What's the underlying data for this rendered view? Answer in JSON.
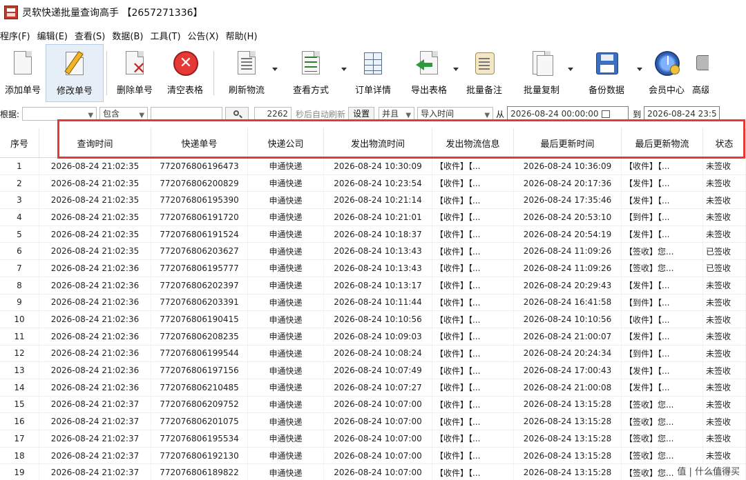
{
  "window": {
    "title": "灵软快递批量查询高手 【2657271336】"
  },
  "menu": [
    "程序(F)",
    "编辑(E)",
    "查看(S)",
    "数据(B)",
    "工具(T)",
    "公告(X)",
    "帮助(H)"
  ],
  "toolbar": {
    "add": "添加单号",
    "edit": "修改单号",
    "delete": "删除单号",
    "clear": "清空表格",
    "refresh": "刷新物流",
    "view_mode": "查看方式",
    "order_detail": "订单详情",
    "export": "导出表格",
    "batch_note": "批量备注",
    "batch_copy": "批量复制",
    "backup": "备份数据",
    "member": "会员中心",
    "more": "高级"
  },
  "filter": {
    "label": "根据:",
    "match_mode": "包含",
    "count": "2262",
    "auto_refresh_text": "秒后自动刷新",
    "settings_btn": "设置",
    "logic": "并且",
    "time_field": "导入时间",
    "from_label": "从",
    "date_from": "2026-08-24 00:00:00",
    "to_label": "到",
    "date_to": "2026-08-24 23:5"
  },
  "table": {
    "headers": [
      "序号",
      "查询时间",
      "快递单号",
      "快递公司",
      "发出物流时间",
      "发出物流信息",
      "最后更新时间",
      "最后更新物流",
      "状态"
    ],
    "rows": [
      [
        "1",
        "2026-08-24 21:02:35",
        "772076806196473",
        "申通快递",
        "2026-08-24 10:30:09",
        "【收件】【...",
        "2026-08-24 10:36:09",
        "【收件】【...",
        "未签收"
      ],
      [
        "2",
        "2026-08-24 21:02:35",
        "772076806200829",
        "申通快递",
        "2026-08-24 10:23:54",
        "【收件】【...",
        "2026-08-24 20:17:36",
        "【发件】【...",
        "未签收"
      ],
      [
        "3",
        "2026-08-24 21:02:35",
        "772076806195390",
        "申通快递",
        "2026-08-24 10:21:14",
        "【收件】【...",
        "2026-08-24 17:35:46",
        "【发件】【...",
        "未签收"
      ],
      [
        "4",
        "2026-08-24 21:02:35",
        "772076806191720",
        "申通快递",
        "2026-08-24 10:21:01",
        "【收件】【...",
        "2026-08-24 20:53:10",
        "【到件】【...",
        "未签收"
      ],
      [
        "5",
        "2026-08-24 21:02:35",
        "772076806191524",
        "申通快递",
        "2026-08-24 10:18:37",
        "【收件】【...",
        "2026-08-24 20:54:19",
        "【发件】【...",
        "未签收"
      ],
      [
        "6",
        "2026-08-24 21:02:35",
        "772076806203627",
        "申通快递",
        "2026-08-24 10:13:43",
        "【收件】【...",
        "2026-08-24 11:09:26",
        "【签收】您...",
        "已签收"
      ],
      [
        "7",
        "2026-08-24 21:02:36",
        "772076806195777",
        "申通快递",
        "2026-08-24 10:13:43",
        "【收件】【...",
        "2026-08-24 11:09:26",
        "【签收】您...",
        "已签收"
      ],
      [
        "8",
        "2026-08-24 21:02:36",
        "772076806202397",
        "申通快递",
        "2026-08-24 10:13:17",
        "【收件】【...",
        "2026-08-24 20:29:43",
        "【发件】【...",
        "未签收"
      ],
      [
        "9",
        "2026-08-24 21:02:36",
        "772076806203391",
        "申通快递",
        "2026-08-24 10:11:44",
        "【收件】【...",
        "2026-08-24 16:41:58",
        "【到件】【...",
        "未签收"
      ],
      [
        "10",
        "2026-08-24 21:02:36",
        "772076806190415",
        "申通快递",
        "2026-08-24 10:10:56",
        "【收件】【...",
        "2026-08-24 10:10:56",
        "【收件】【...",
        "未签收"
      ],
      [
        "11",
        "2026-08-24 21:02:36",
        "772076806208235",
        "申通快递",
        "2026-08-24 10:09:03",
        "【收件】【...",
        "2026-08-24 21:00:07",
        "【发件】【...",
        "未签收"
      ],
      [
        "12",
        "2026-08-24 21:02:36",
        "772076806199544",
        "申通快递",
        "2026-08-24 10:08:24",
        "【收件】【...",
        "2026-08-24 20:24:34",
        "【到件】【...",
        "未签收"
      ],
      [
        "13",
        "2026-08-24 21:02:36",
        "772076806197156",
        "申通快递",
        "2026-08-24 10:07:49",
        "【收件】【...",
        "2026-08-24 17:00:43",
        "【发件】【...",
        "未签收"
      ],
      [
        "14",
        "2026-08-24 21:02:36",
        "772076806210485",
        "申通快递",
        "2026-08-24 10:07:27",
        "【收件】【...",
        "2026-08-24 21:00:08",
        "【发件】【...",
        "未签收"
      ],
      [
        "15",
        "2026-08-24 21:02:37",
        "772076806209752",
        "申通快递",
        "2026-08-24 10:07:00",
        "【收件】【...",
        "2026-08-24 13:15:28",
        "【签收】您...",
        "未签收"
      ],
      [
        "16",
        "2026-08-24 21:02:37",
        "772076806201075",
        "申通快递",
        "2026-08-24 10:07:00",
        "【收件】【...",
        "2026-08-24 13:15:28",
        "【签收】您...",
        "未签收"
      ],
      [
        "17",
        "2026-08-24 21:02:37",
        "772076806195534",
        "申通快递",
        "2026-08-24 10:07:00",
        "【收件】【...",
        "2026-08-24 13:15:28",
        "【签收】您...",
        "未签收"
      ],
      [
        "18",
        "2026-08-24 21:02:37",
        "772076806192130",
        "申通快递",
        "2026-08-24 10:07:00",
        "【收件】【...",
        "2026-08-24 13:15:28",
        "【签收】您...",
        "未签收"
      ],
      [
        "19",
        "2026-08-24 21:02:37",
        "772076806189822",
        "申通快递",
        "2026-08-24 10:07:00",
        "【收件】【...",
        "2026-08-24 13:15:28",
        "【签收】您...",
        "未签收"
      ]
    ]
  },
  "watermark": "值 | 什么值得买",
  "colors": {
    "highlight": "#e53935",
    "accent": "#3a6fc4"
  }
}
